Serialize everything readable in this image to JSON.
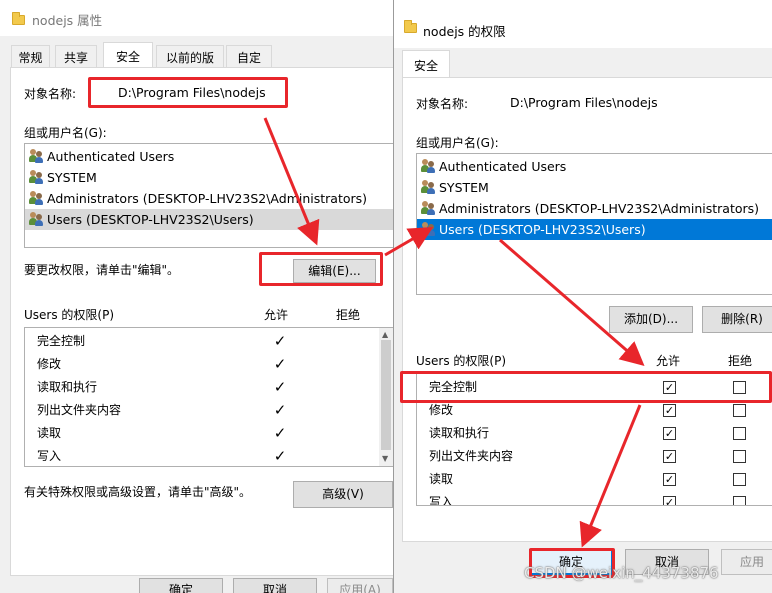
{
  "back_dialog": {
    "title": "nodejs 属性",
    "tabs": [
      "常规",
      "共享",
      "安全",
      "以前的版本",
      "自定义"
    ],
    "active_tab": "安全",
    "object_name_label": "对象名称:",
    "object_name_value": "D:\\Program Files\\nodejs",
    "group_label": "组或用户名(G):",
    "users": [
      "Authenticated Users",
      "SYSTEM",
      "Administrators (DESKTOP-LHV23S2\\Administrators)",
      "Users (DESKTOP-LHV23S2\\Users)"
    ],
    "edit_hint": "要更改权限，请单击\"编辑\"。",
    "edit_button": "编辑(E)...",
    "perm_label": "Users 的权限(P)",
    "allow_header": "允许",
    "deny_header": "拒绝",
    "permissions": [
      {
        "name": "完全控制",
        "allow": "",
        "deny": ""
      },
      {
        "name": "修改",
        "allow": "",
        "deny": ""
      },
      {
        "name": "读取和执行",
        "allow": "✓",
        "deny": ""
      },
      {
        "name": "列出文件夹内容",
        "allow": "✓",
        "deny": ""
      },
      {
        "name": "读取",
        "allow": "✓",
        "deny": ""
      },
      {
        "name": "写入",
        "allow": "",
        "deny": ""
      }
    ],
    "advanced_hint": "有关特殊权限或高级设置，请单击\"高级\"。",
    "advanced_button": "高级(V)",
    "ok_button": "确定",
    "cancel_button": "取消",
    "apply_button": "应用(A)"
  },
  "front_dialog": {
    "title": "nodejs 的权限",
    "tab": "安全",
    "object_name_label": "对象名称:",
    "object_name_value": "D:\\Program Files\\nodejs",
    "group_label": "组或用户名(G):",
    "users": [
      "Authenticated Users",
      "SYSTEM",
      "Administrators (DESKTOP-LHV23S2\\Administrators)",
      "Users (DESKTOP-LHV23S2\\Users)"
    ],
    "selected_user_index": 3,
    "add_button": "添加(D)...",
    "remove_button": "删除(R)",
    "perm_label": "Users 的权限(P)",
    "allow_header": "允许",
    "deny_header": "拒绝",
    "permissions": [
      {
        "name": "完全控制",
        "allow": "✓",
        "deny": ""
      },
      {
        "name": "修改",
        "allow": "✓",
        "deny": ""
      },
      {
        "name": "读取和执行",
        "allow": "✓",
        "deny": ""
      },
      {
        "name": "列出文件夹内容",
        "allow": "✓",
        "deny": ""
      },
      {
        "name": "读取",
        "allow": "✓",
        "deny": ""
      },
      {
        "name": "写入",
        "allow": "✓",
        "deny": ""
      }
    ],
    "ok_button": "确定",
    "cancel_button": "取消",
    "apply_button": "应用(A)"
  },
  "watermark": "CSDN @weixin_44373876",
  "colors": {
    "annotation_red": "#e8262b",
    "selection_blue": "#0078d7",
    "dialog_bg": "#f0f0f0"
  }
}
